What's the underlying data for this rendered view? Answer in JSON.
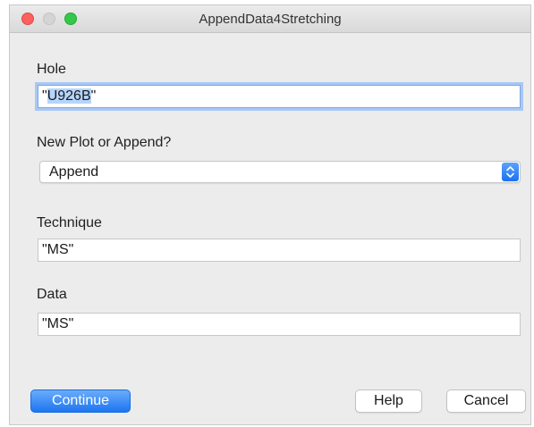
{
  "window": {
    "title": "AppendData4Stretching"
  },
  "form": {
    "hole": {
      "label": "Hole",
      "value": "\"U926B\"",
      "selected_text": "U926B"
    },
    "mode": {
      "label": "New Plot or Append?",
      "selected": "Append"
    },
    "technique": {
      "label": "Technique",
      "value": "\"MS\""
    },
    "data": {
      "label": "Data",
      "value": "\"MS\""
    }
  },
  "buttons": {
    "continue": "Continue",
    "help": "Help",
    "cancel": "Cancel"
  },
  "colors": {
    "accent": "#1d75f0",
    "selection": "#b5d5fd",
    "close": "#fc615d",
    "maximize": "#34c84a"
  }
}
